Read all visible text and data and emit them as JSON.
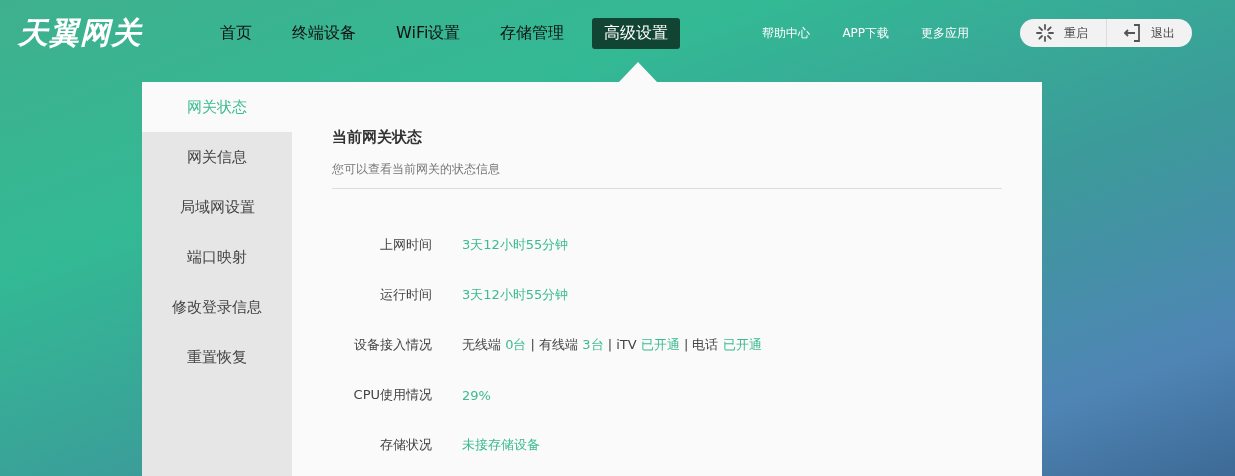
{
  "logo": "天翼网关",
  "nav": [
    {
      "label": "首页",
      "selected": false
    },
    {
      "label": "终端设备",
      "selected": false
    },
    {
      "label": "WiFi设置",
      "selected": false
    },
    {
      "label": "存储管理",
      "selected": false
    },
    {
      "label": "高级设置",
      "selected": true
    }
  ],
  "links": [
    "帮助中心",
    "APP下载",
    "更多应用"
  ],
  "actions": [
    {
      "kind": "restart",
      "label": "重启"
    },
    {
      "kind": "logout",
      "label": "退出"
    }
  ],
  "sidebar": [
    {
      "label": "网关状态",
      "selected": true
    },
    {
      "label": "网关信息",
      "selected": false
    },
    {
      "label": "局域网设置",
      "selected": false
    },
    {
      "label": "端口映射",
      "selected": false
    },
    {
      "label": "修改登录信息",
      "selected": false
    },
    {
      "label": "重置恢复",
      "selected": false
    }
  ],
  "section": {
    "title": "当前网关状态",
    "subtitle": "您可以查看当前网关的状态信息"
  },
  "rows": [
    {
      "label": "上网时间",
      "value": [
        {
          "kind": "value",
          "text": "3天12小时55分钟"
        }
      ]
    },
    {
      "label": "运行时间",
      "value": [
        {
          "kind": "value",
          "text": "3天12小时55分钟"
        }
      ]
    },
    {
      "label": "设备接入情况",
      "value": [
        {
          "kind": "text",
          "text": "无线端"
        },
        {
          "kind": "value",
          "text": "0台"
        },
        {
          "kind": "sep",
          "text": "|"
        },
        {
          "kind": "text",
          "text": "有线端"
        },
        {
          "kind": "value",
          "text": "3台"
        },
        {
          "kind": "sep",
          "text": "|"
        },
        {
          "kind": "text",
          "text": "iTV"
        },
        {
          "kind": "value",
          "text": "已开通"
        },
        {
          "kind": "sep",
          "text": "|"
        },
        {
          "kind": "text",
          "text": "电话"
        },
        {
          "kind": "value",
          "text": "已开通"
        }
      ]
    },
    {
      "label": "CPU使用情况",
      "value": [
        {
          "kind": "value",
          "text": "29%"
        }
      ]
    },
    {
      "label": "存储状况",
      "value": [
        {
          "kind": "value",
          "text": "未接存储设备"
        }
      ]
    }
  ]
}
